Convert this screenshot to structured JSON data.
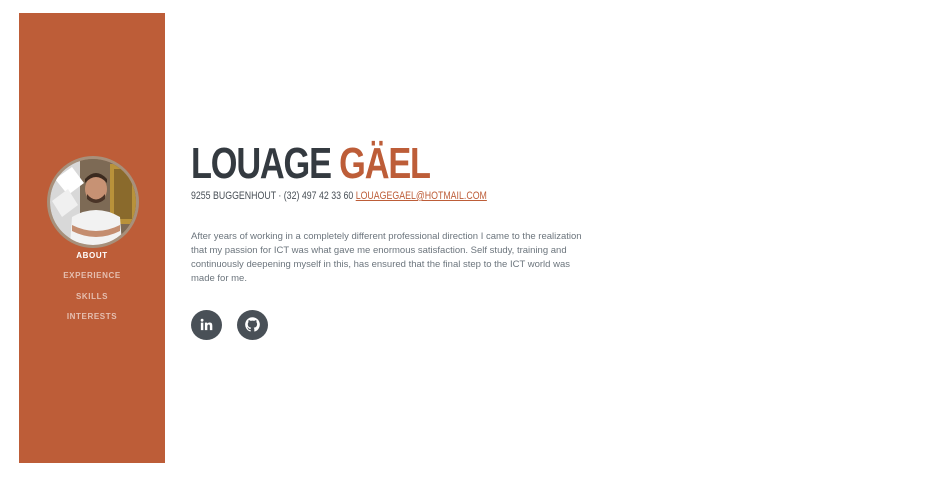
{
  "sidebar": {
    "background": "#bd5d38",
    "nav": [
      {
        "label": "ABOUT",
        "active": true
      },
      {
        "label": "EXPERIENCE",
        "active": false
      },
      {
        "label": "SKILLS",
        "active": false
      },
      {
        "label": "INTERESTS",
        "active": false
      }
    ]
  },
  "about": {
    "first_name": "LOUAGE",
    "last_name": "GÄEL",
    "address": "9255 BUGGENHOUT · (32) 497 42 33 60",
    "email": "LOUAGEGAEL@HOTMAIL.COM",
    "intro": "After years of working in a completely different professional direction I came to the realization that my passion for ICT was what gave me enormous satisfaction. Self study, training and continuously deepening myself in this, has ensured that the final step to the ICT world was made for me."
  },
  "social": [
    {
      "icon": "linkedin-icon"
    },
    {
      "icon": "github-icon"
    }
  ],
  "colors": {
    "accent": "#bd5d38",
    "heading": "#343a40",
    "text": "#6c757d",
    "social_bg": "#495057"
  }
}
